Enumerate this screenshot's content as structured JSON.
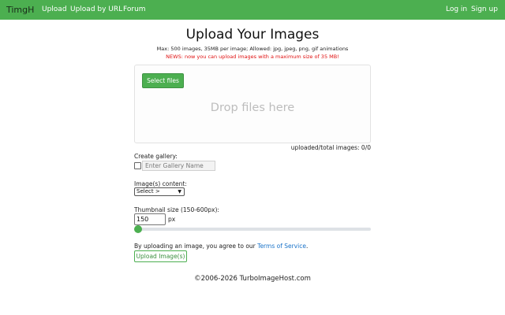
{
  "navbar": {
    "brand": "TimgH",
    "links": [
      "Upload",
      "Upload by URL",
      "Forum"
    ],
    "login": "Log in",
    "signup": "Sign up",
    "color": "#4caf50"
  },
  "main": {
    "title": "Upload Your Images",
    "info": "Max: 500 images, 35MB per image; Allowed: jpg, jpeg, png, gif animations",
    "news": "NEWS: now you can upload images with a maximum size of 35 MB!",
    "select_files_label": "Select files",
    "drop_text": "Drop files here",
    "counter": "uploaded/total images: 0/0"
  },
  "gallery": {
    "label": "Create gallery:",
    "checked": false,
    "placeholder": "Enter Gallery Name"
  },
  "content": {
    "label": "Image(s) content:",
    "selected": "Select >"
  },
  "thumbnail": {
    "label": "Thumbnail size (150-600px):",
    "value": "150",
    "unit": "px",
    "min": 150,
    "max": 600,
    "current": 150
  },
  "tos": {
    "prefix": "By uploading an image, you agree to our ",
    "link": "Terms of Service",
    "suffix": "."
  },
  "upload_button": "Upload Image(s)",
  "footer": "©2006-2026 TurboImageHost.com"
}
